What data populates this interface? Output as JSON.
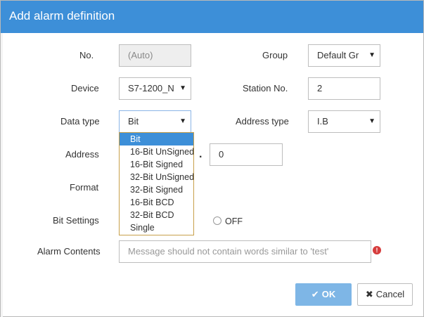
{
  "dialog": {
    "title": "Add alarm definition"
  },
  "labels": {
    "no": "No.",
    "group": "Group",
    "device": "Device",
    "station_no": "Station No.",
    "data_type": "Data type",
    "address_type": "Address type",
    "address": "Address",
    "format": "Format",
    "bit_settings": "Bit Settings",
    "alarm_contents": "Alarm Contents"
  },
  "fields": {
    "no_value": "(Auto)",
    "group_value": "Default Gr",
    "device_value": "S7-1200_N",
    "station_no_value": "2",
    "data_type_value": "Bit",
    "address_type_value": "I.B",
    "address_bit_value": "0",
    "alarm_contents_placeholder": "Message should not contain words similar to 'test'"
  },
  "address_separator": ".",
  "data_type_options": [
    "Bit",
    "16-Bit UnSigned",
    "16-Bit Signed",
    "32-Bit UnSigned",
    "32-Bit Signed",
    "16-Bit BCD",
    "32-Bit BCD",
    "Single"
  ],
  "data_type_selected_index": 0,
  "bit_settings": {
    "off_label": "OFF"
  },
  "buttons": {
    "ok": "OK",
    "cancel": "Cancel"
  },
  "icons": {
    "ok": "check-icon",
    "cancel": "x-icon",
    "error": "exclamation-icon",
    "select": "caret-down-icon"
  },
  "colors": {
    "titlebar": "#3d8fd8",
    "ok_button": "#7eb6e6",
    "error": "#d63c3c",
    "dropdown_border": "#c8a04a"
  }
}
